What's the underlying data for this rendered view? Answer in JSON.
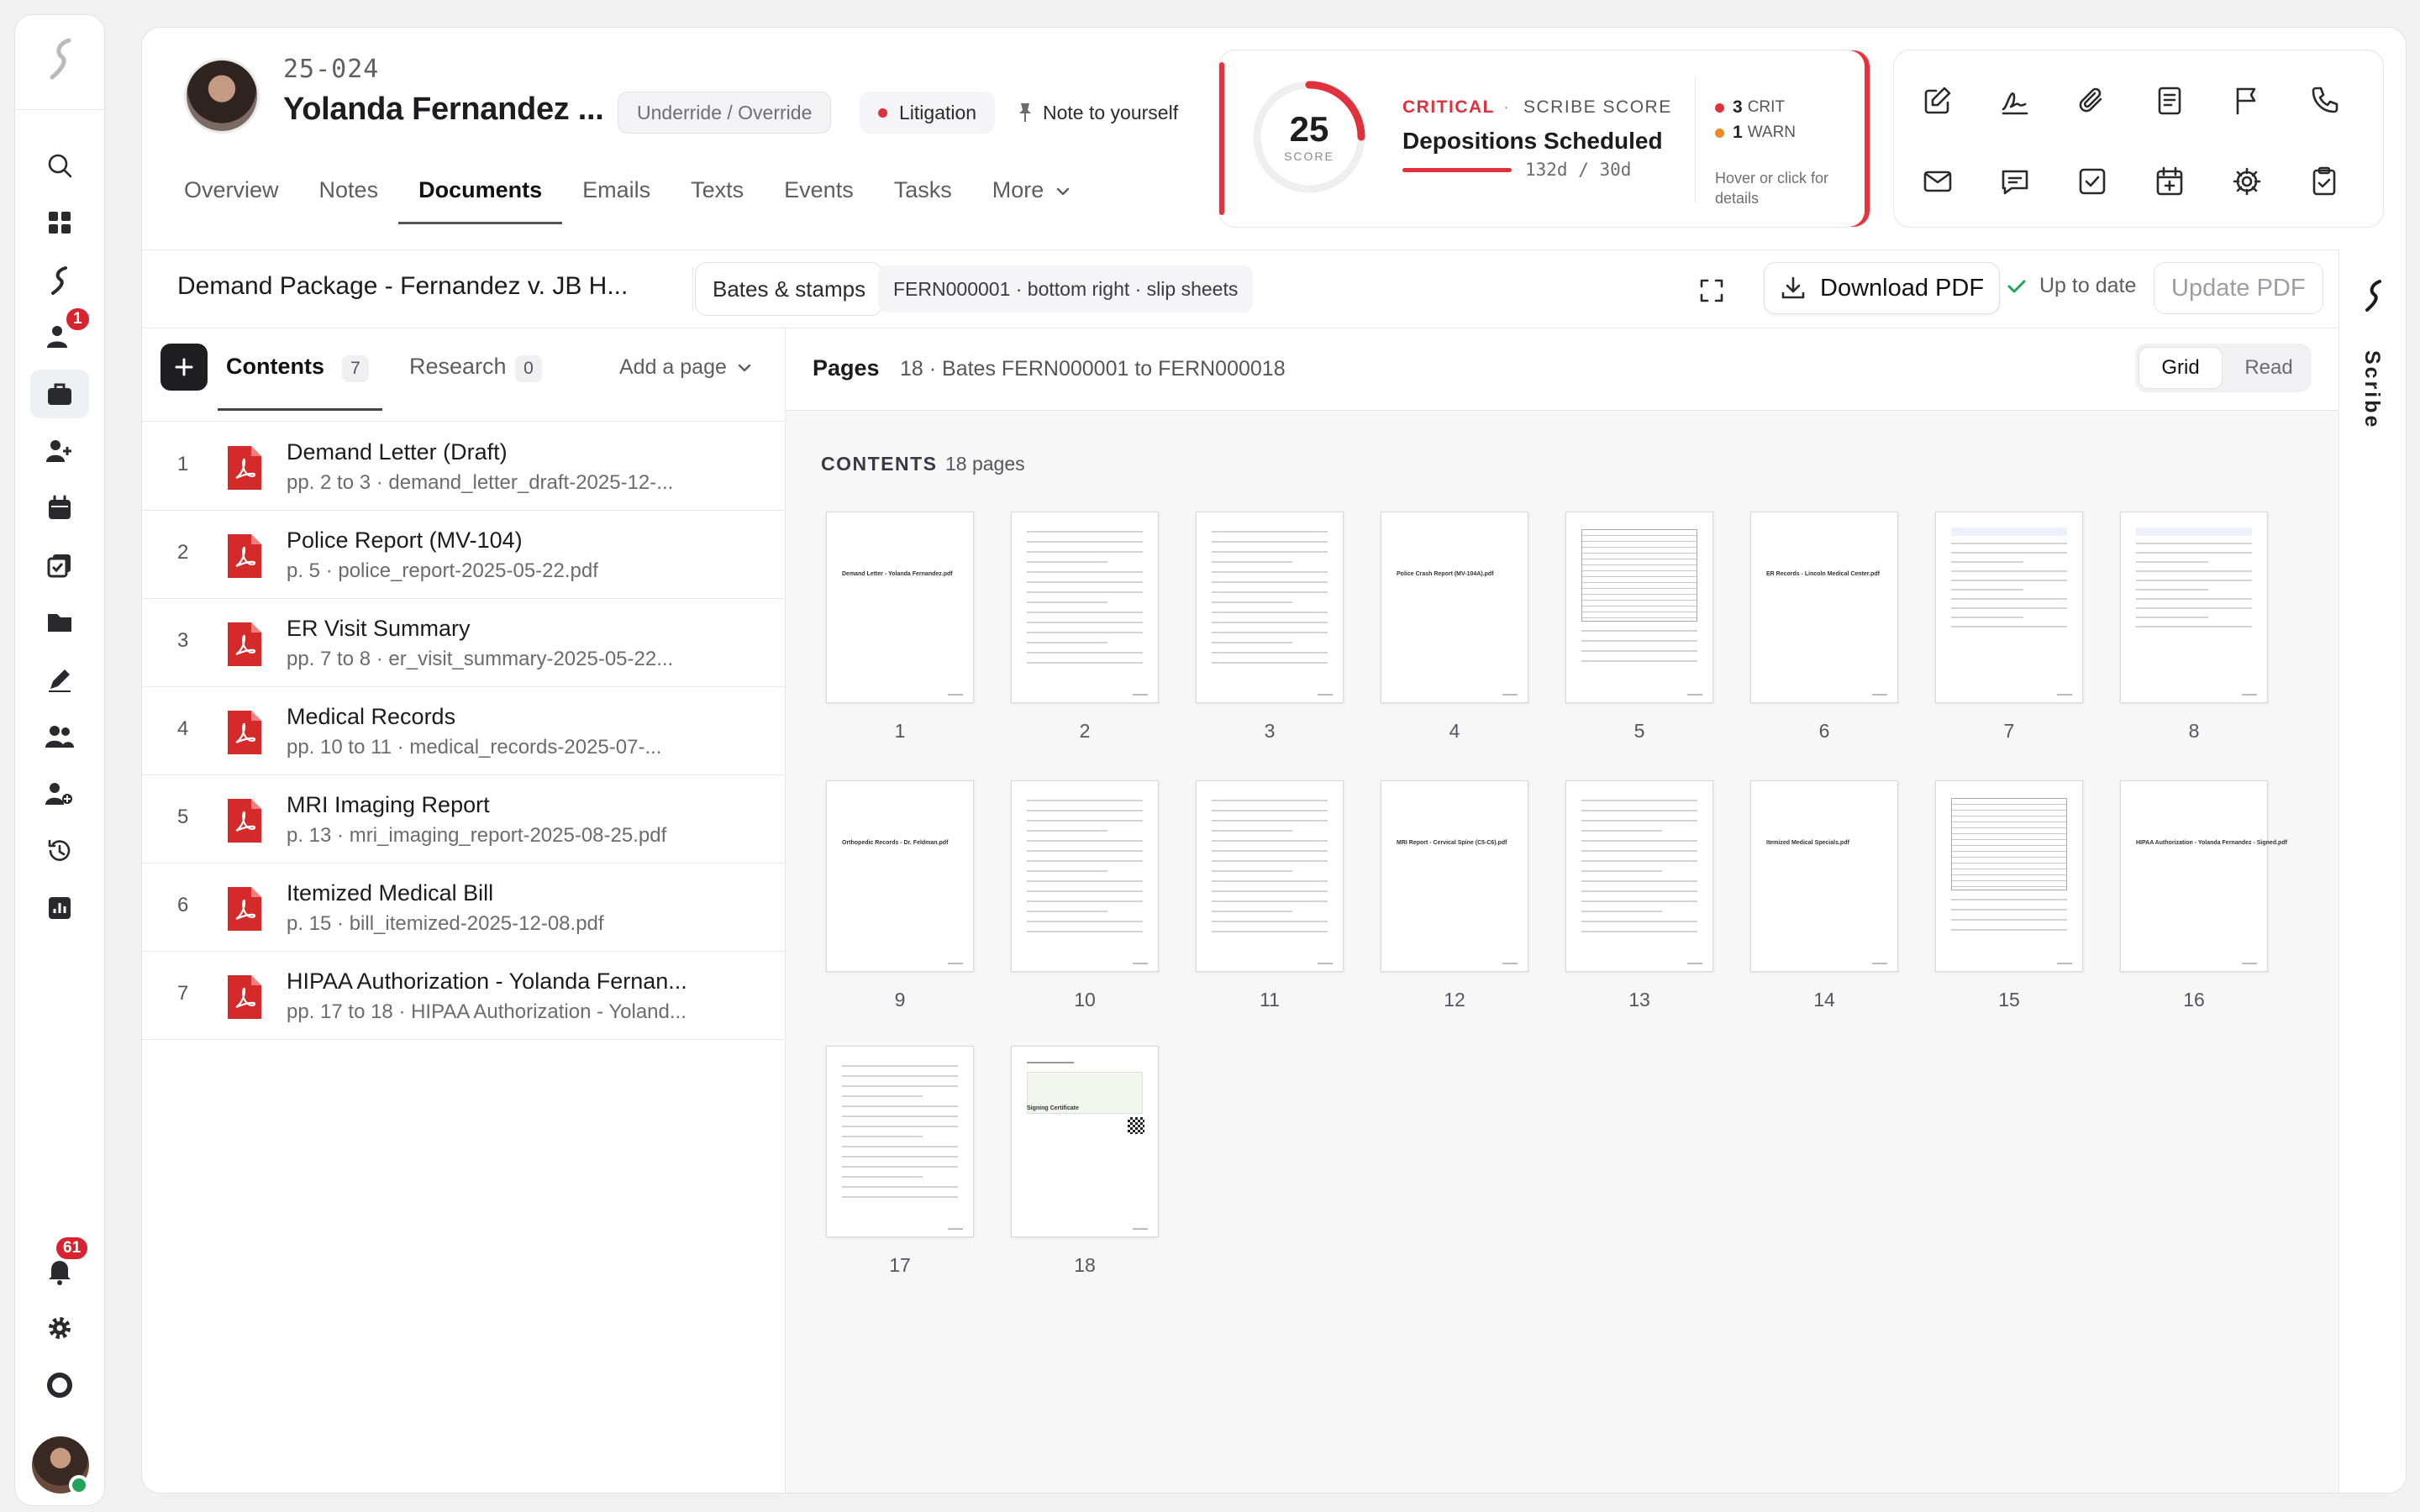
{
  "rail": {
    "notifications_badge": "1",
    "alerts_badge": "61"
  },
  "header": {
    "case_number": "25-024",
    "client_name": "Yolanda Fernandez ...",
    "underride_label": "Underride / Override",
    "status_label": "Litigation",
    "note_label": "Note to yourself",
    "tabs": [
      {
        "label": "Overview"
      },
      {
        "label": "Notes"
      },
      {
        "label": "Documents"
      },
      {
        "label": "Emails"
      },
      {
        "label": "Texts"
      },
      {
        "label": "Events"
      },
      {
        "label": "Tasks"
      },
      {
        "label": "More"
      }
    ]
  },
  "score": {
    "value": "25",
    "caption": "SCORE",
    "fraction": 0.25,
    "severity": "CRITICAL",
    "separator": "·",
    "label": "SCRIBE SCORE",
    "title": "Depositions Scheduled",
    "days": "132d / 30d",
    "crit_count": "3",
    "crit_label": "CRIT",
    "warn_count": "1",
    "warn_label": "WARN",
    "hint": "Hover or click for details",
    "crit_color": "#e0313c",
    "warn_color": "#f08a24"
  },
  "toolbar": {
    "doc_title": "Demand Package - Fernandez v. JB H...",
    "bates_label": "Bates & stamps",
    "bates_info": "FERN000001 · bottom right · slip sheets",
    "download_label": "Download PDF",
    "status_label": "Up to date",
    "update_label": "Update PDF"
  },
  "scribe_panel": {
    "label": "Scribe"
  },
  "left_panel": {
    "contents_label": "Contents",
    "contents_count": "7",
    "research_label": "Research",
    "research_count": "0",
    "add_page_label": "Add a page",
    "documents": [
      {
        "num": "1",
        "title": "Demand Letter (Draft)",
        "sub": "pp. 2 to 3 · demand_letter_draft-2025-12-..."
      },
      {
        "num": "2",
        "title": "Police Report (MV-104)",
        "sub": "p. 5 · police_report-2025-05-22.pdf"
      },
      {
        "num": "3",
        "title": "ER Visit Summary",
        "sub": "pp. 7 to 8 · er_visit_summary-2025-05-22..."
      },
      {
        "num": "4",
        "title": "Medical Records",
        "sub": "pp. 10 to 11 · medical_records-2025-07-..."
      },
      {
        "num": "5",
        "title": "MRI Imaging Report",
        "sub": "p. 13 · mri_imaging_report-2025-08-25.pdf"
      },
      {
        "num": "6",
        "title": "Itemized Medical Bill",
        "sub": "p. 15 · bill_itemized-2025-12-08.pdf"
      },
      {
        "num": "7",
        "title": "HIPAA Authorization - Yolanda Fernan...",
        "sub": "pp. 17 to 18 · HIPAA Authorization - Yoland..."
      }
    ]
  },
  "pages_panel": {
    "label": "Pages",
    "info": "18 · Bates FERN000001 to FERN000018",
    "view_grid": "Grid",
    "view_read": "Read",
    "contents_label": "CONTENTS",
    "contents_count": "18 pages",
    "pages": [
      {
        "num": "1",
        "slip": "Demand Letter - Yolanda Fernandez.pdf"
      },
      {
        "num": "2",
        "slip": ""
      },
      {
        "num": "3",
        "slip": ""
      },
      {
        "num": "4",
        "slip": "Police Crash Report (MV-104A).pdf"
      },
      {
        "num": "5",
        "slip": ""
      },
      {
        "num": "6",
        "slip": "ER Records - Lincoln Medical Center.pdf"
      },
      {
        "num": "7",
        "slip": ""
      },
      {
        "num": "8",
        "slip": ""
      },
      {
        "num": "9",
        "slip": "Orthopedic Records - Dr. Feldman.pdf"
      },
      {
        "num": "10",
        "slip": ""
      },
      {
        "num": "11",
        "slip": ""
      },
      {
        "num": "12",
        "slip": "MRI Report - Cervical Spine (C5-C6).pdf"
      },
      {
        "num": "13",
        "slip": ""
      },
      {
        "num": "14",
        "slip": "Itemized Medical Specials.pdf"
      },
      {
        "num": "15",
        "slip": ""
      },
      {
        "num": "16",
        "slip": "HIPAA Authorization - Yolanda Fernandez - Signed.pdf"
      },
      {
        "num": "17",
        "slip": ""
      },
      {
        "num": "18",
        "slip": "Signing Certificate"
      }
    ]
  }
}
